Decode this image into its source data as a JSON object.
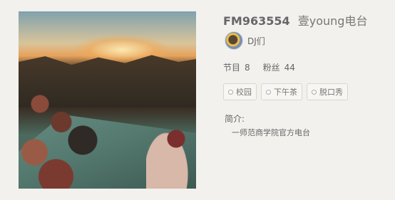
{
  "station": {
    "code": "FM963554",
    "name": "壹young电台"
  },
  "dj": {
    "label": "DJ们"
  },
  "stats": {
    "programs_label": "节目",
    "programs_count": "8",
    "fans_label": "粉丝",
    "fans_count": "44"
  },
  "tags": [
    {
      "label": "校园"
    },
    {
      "label": "下午茶"
    },
    {
      "label": "脱口秀"
    }
  ],
  "intro": {
    "title": "简介:",
    "text": "一师范商学院官方电台"
  }
}
